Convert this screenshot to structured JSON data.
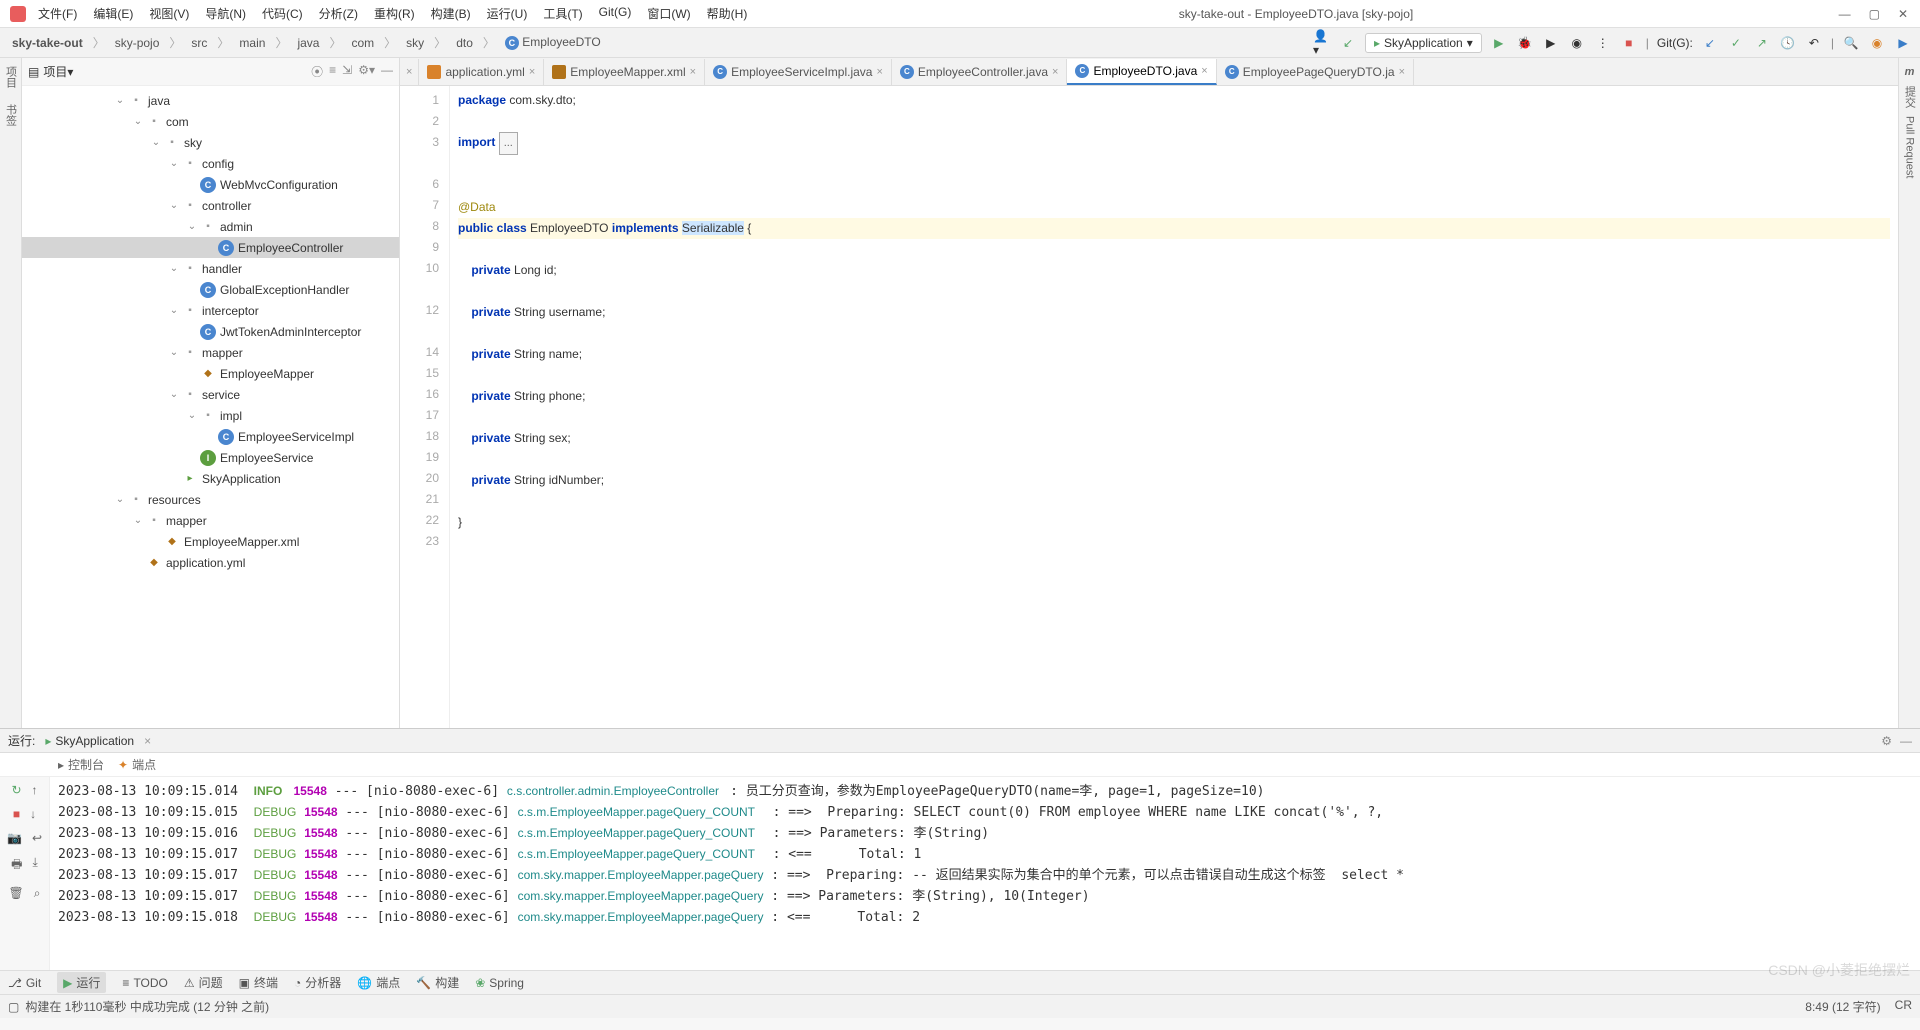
{
  "window": {
    "title": "sky-take-out - EmployeeDTO.java [sky-pojo]"
  },
  "menu": [
    "文件(F)",
    "编辑(E)",
    "视图(V)",
    "导航(N)",
    "代码(C)",
    "分析(Z)",
    "重构(R)",
    "构建(B)",
    "运行(U)",
    "工具(T)",
    "Git(G)",
    "窗口(W)",
    "帮助(H)"
  ],
  "breadcrumbs": [
    "sky-take-out",
    "sky-pojo",
    "src",
    "main",
    "java",
    "com",
    "sky",
    "dto",
    "EmployeeDTO"
  ],
  "runConfig": {
    "name": "SkyApplication"
  },
  "gitLabel": "Git(G):",
  "project": {
    "label": "项目",
    "tree": [
      {
        "level": 5,
        "arrow": "v",
        "icon": "folder",
        "label": "java"
      },
      {
        "level": 6,
        "arrow": "v",
        "icon": "folder",
        "label": "com"
      },
      {
        "level": 7,
        "arrow": "v",
        "icon": "folder",
        "label": "sky"
      },
      {
        "level": 8,
        "arrow": "v",
        "icon": "folder",
        "label": "config"
      },
      {
        "level": 9,
        "arrow": "",
        "icon": "class",
        "label": "WebMvcConfiguration"
      },
      {
        "level": 8,
        "arrow": "v",
        "icon": "folder",
        "label": "controller"
      },
      {
        "level": 9,
        "arrow": "v",
        "icon": "folder",
        "label": "admin"
      },
      {
        "level": 10,
        "arrow": "",
        "icon": "class",
        "label": "EmployeeController",
        "sel": true
      },
      {
        "level": 8,
        "arrow": "v",
        "icon": "folder",
        "label": "handler"
      },
      {
        "level": 9,
        "arrow": "",
        "icon": "class",
        "label": "GlobalExceptionHandler"
      },
      {
        "level": 8,
        "arrow": "v",
        "icon": "folder",
        "label": "interceptor"
      },
      {
        "level": 9,
        "arrow": "",
        "icon": "class",
        "label": "JwtTokenAdminInterceptor"
      },
      {
        "level": 8,
        "arrow": "v",
        "icon": "folder",
        "label": "mapper"
      },
      {
        "level": 9,
        "arrow": "",
        "icon": "xml",
        "label": "EmployeeMapper"
      },
      {
        "level": 8,
        "arrow": "v",
        "icon": "folder",
        "label": "service"
      },
      {
        "level": 9,
        "arrow": "v",
        "icon": "folder",
        "label": "impl"
      },
      {
        "level": 10,
        "arrow": "",
        "icon": "class",
        "label": "EmployeeServiceImpl"
      },
      {
        "level": 9,
        "arrow": "",
        "icon": "intf",
        "label": "EmployeeService"
      },
      {
        "level": 8,
        "arrow": "",
        "icon": "run",
        "label": "SkyApplication"
      },
      {
        "level": 5,
        "arrow": "v",
        "icon": "folder",
        "label": "resources"
      },
      {
        "level": 6,
        "arrow": "v",
        "icon": "folder",
        "label": "mapper"
      },
      {
        "level": 7,
        "arrow": "",
        "icon": "xml",
        "label": "EmployeeMapper.xml"
      },
      {
        "level": 6,
        "arrow": "",
        "icon": "xml",
        "label": "application.yml"
      }
    ]
  },
  "tabs": [
    {
      "icon": "y",
      "label": "application.yml",
      "active": false
    },
    {
      "icon": "x",
      "label": "EmployeeMapper.xml",
      "active": false
    },
    {
      "icon": "j",
      "label": "EmployeeServiceImpl.java",
      "active": false
    },
    {
      "icon": "j",
      "label": "EmployeeController.java",
      "active": false
    },
    {
      "icon": "j",
      "label": "EmployeeDTO.java",
      "active": true
    },
    {
      "icon": "j",
      "label": "EmployeePageQueryDTO.ja",
      "active": false
    }
  ],
  "code": {
    "lines": [
      1,
      2,
      3,
      "",
      6,
      7,
      8,
      9,
      10,
      "",
      12,
      "",
      14,
      15,
      16,
      17,
      18,
      19,
      20,
      21,
      22,
      23
    ],
    "package": "package com.sky.dto;",
    "import": "import ",
    "fold": "...",
    "ann": "@Data",
    "l8_1": "public class ",
    "l8_2": "EmployeeDTO ",
    "l8_3": "implements ",
    "l8_4": "Serializable",
    "l8_5": " {",
    "l10": "    private Long id;",
    "l12": "    private String username;",
    "l14": "    private String name;",
    "l16": "    private String phone;",
    "l18": "    private String sex;",
    "l20": "    private String idNumber;",
    "l22": "}"
  },
  "sidebars": {
    "left1": "项目",
    "left2": "书签",
    "right1": "m",
    "right2": "提交",
    "right3": "Pull Request"
  },
  "run": {
    "label": "运行:",
    "app": "SkyApplication",
    "tabs": {
      "console": "控制台",
      "endpoint": "端点"
    },
    "log": [
      {
        "ts": "2023-08-13 10:09:15.014",
        "lvl": "INFO ",
        "pid": "15548",
        "thr": "[nio-8080-exec-6]",
        "src": "c.s.controller.admin.EmployeeController ",
        "msg": ": 员工分页查询，参数为EmployeePageQueryDTO(name=李, page=1, pageSize=10)"
      },
      {
        "ts": "2023-08-13 10:09:15.015",
        "lvl": "DEBUG",
        "pid": "15548",
        "thr": "[nio-8080-exec-6]",
        "src": "c.s.m.EmployeeMapper.pageQuery_COUNT   ",
        "msg": ": ==>  Preparing: SELECT count(0) FROM employee WHERE name LIKE concat('%', ?,"
      },
      {
        "ts": "2023-08-13 10:09:15.016",
        "lvl": "DEBUG",
        "pid": "15548",
        "thr": "[nio-8080-exec-6]",
        "src": "c.s.m.EmployeeMapper.pageQuery_COUNT   ",
        "msg": ": ==> Parameters: 李(String)"
      },
      {
        "ts": "2023-08-13 10:09:15.017",
        "lvl": "DEBUG",
        "pid": "15548",
        "thr": "[nio-8080-exec-6]",
        "src": "c.s.m.EmployeeMapper.pageQuery_COUNT   ",
        "msg": ": <==      Total: 1"
      },
      {
        "ts": "2023-08-13 10:09:15.017",
        "lvl": "DEBUG",
        "pid": "15548",
        "thr": "[nio-8080-exec-6]",
        "src": "com.sky.mapper.EmployeeMapper.pageQuery",
        "msg": ": ==>  Preparing: -- 返回结果实际为集合中的单个元素，可以点击错误自动生成这个标签  select *"
      },
      {
        "ts": "2023-08-13 10:09:15.017",
        "lvl": "DEBUG",
        "pid": "15548",
        "thr": "[nio-8080-exec-6]",
        "src": "com.sky.mapper.EmployeeMapper.pageQuery",
        "msg": ": ==> Parameters: 李(String), 10(Integer)"
      },
      {
        "ts": "2023-08-13 10:09:15.018",
        "lvl": "DEBUG",
        "pid": "15548",
        "thr": "[nio-8080-exec-6]",
        "src": "com.sky.mapper.EmployeeMapper.pageQuery",
        "msg": ": <==      Total: 2"
      }
    ]
  },
  "bottom": {
    "git": "Git",
    "run": "运行",
    "todo": "TODO",
    "problems": "问题",
    "terminal": "终端",
    "analyzer": "分析器",
    "endpoints": "端点",
    "build": "构建",
    "spring": "Spring"
  },
  "status": {
    "left": "构建在 1秒110毫秒 中成功完成 (12 分钟 之前)",
    "pos": "8:49 (12 字符)",
    "enc": "CR",
    "watermark": "CSDN @小菱拒绝摆烂"
  }
}
